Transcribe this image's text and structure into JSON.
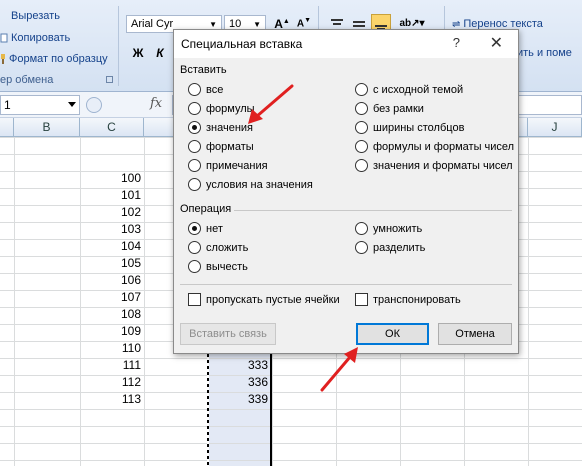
{
  "ribbon": {
    "cut_label": "Вырезать",
    "copy_label": "Копировать",
    "format_painter_label": "Формат по образцу",
    "clipboard_group_label": "ер обмена",
    "font_name": "Arial Cyr",
    "font_size": "10",
    "bold_label": "Ж",
    "italic_label": "К",
    "wrap_text_label": "Перенос текста",
    "merge_label": "ить и поме"
  },
  "formula_bar": {
    "name_box_value": "1",
    "fx_label": "fx"
  },
  "grid": {
    "columns": [
      "B",
      "C",
      "",
      "",
      "",
      "",
      "J"
    ],
    "values_c": [
      "100",
      "101",
      "102",
      "103",
      "104",
      "105",
      "106",
      "107",
      "108",
      "109",
      "110",
      "111",
      "112",
      "113"
    ],
    "values_d": [
      "333",
      "336",
      "339"
    ]
  },
  "dialog": {
    "title": "Специальная вставка",
    "help_label": "?",
    "close_label": "✕",
    "paste_section_label": "Вставить",
    "paste_options_left": [
      {
        "label": "все",
        "checked": false
      },
      {
        "label": "формулы",
        "checked": false
      },
      {
        "label": "значения",
        "checked": true
      },
      {
        "label": "форматы",
        "checked": false
      },
      {
        "label": "примечания",
        "checked": false
      },
      {
        "label": "условия на значения",
        "checked": false
      }
    ],
    "paste_options_right": [
      {
        "label": "с исходной темой",
        "checked": false
      },
      {
        "label": "без рамки",
        "checked": false
      },
      {
        "label": "ширины столбцов",
        "checked": false
      },
      {
        "label": "формулы и форматы чисел",
        "checked": false
      },
      {
        "label": "значения и форматы чисел",
        "checked": false
      }
    ],
    "operation_section_label": "Операция",
    "operation_left": [
      {
        "label": "нет",
        "checked": true
      },
      {
        "label": "сложить",
        "checked": false
      },
      {
        "label": "вычесть",
        "checked": false
      }
    ],
    "operation_right": [
      {
        "label": "умножить",
        "checked": false
      },
      {
        "label": "разделить",
        "checked": false
      }
    ],
    "skip_blanks_label": "пропускать пустые ячейки",
    "transpose_label": "транспонировать",
    "paste_link_label": "Вставить связь",
    "ok_label": "ОК",
    "cancel_label": "Отмена"
  },
  "colors": {
    "annotation_arrow": "#e02020",
    "default_button_border": "#0078d7",
    "ribbon_text": "#15428b"
  }
}
